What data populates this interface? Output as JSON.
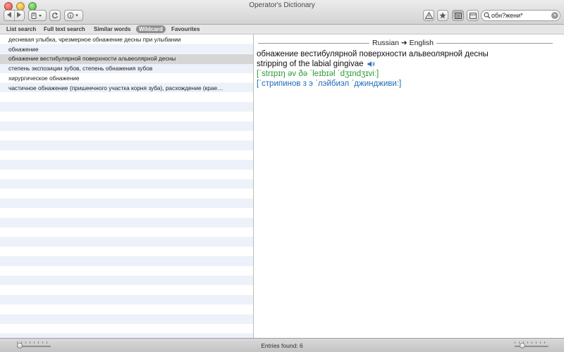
{
  "window": {
    "title": "Operator's Dictionary"
  },
  "toolbar": {
    "back_icon": "chevron-left-icon",
    "forward_icon": "chevron-right-icon",
    "bookmark_menu_icon": "bookmark-menu-icon",
    "refresh_icon": "refresh-icon",
    "info_menu_icon": "info-menu-icon",
    "warning_icon": "warning-triangle-icon",
    "favourite_icon": "star-icon",
    "list_view_icon": "list-view-icon",
    "panel_icon": "panel-icon"
  },
  "search": {
    "value": "обн?жени*",
    "placeholder": ""
  },
  "tabs": [
    {
      "label": "List search",
      "active": false
    },
    {
      "label": "Full text search",
      "active": false
    },
    {
      "label": "Similar words",
      "active": false
    },
    {
      "label": "Wildcard",
      "active": true
    },
    {
      "label": "Favourites",
      "active": false
    }
  ],
  "results": [
    {
      "text": "десневая улыбка, чрезмерное обнажение десны при улыбании",
      "selected": false
    },
    {
      "text": "обнажение",
      "selected": false
    },
    {
      "text": "обнажение вестибулярной поверхности альвеолярной десны",
      "selected": true
    },
    {
      "text": "степень экспозиции зубов, степень обнажения зубов",
      "selected": false
    },
    {
      "text": "хирургическое обнажение",
      "selected": false
    },
    {
      "text": "частичное обнажение (пришеечного участка корня зуба), расхождение (крае…",
      "selected": false
    }
  ],
  "entry": {
    "direction": "Russian ➜ English",
    "headword": "обнажение вестибулярной поверхности альвеолярной десны",
    "translation": "stripping of the labial gingivae",
    "ipa": "[ˈstrɪpɪŋ əv ðə ˈleɪbɪəl ˈdʒɪndʒɪviː]",
    "transliteration": "[ˈстрипинов з э ˈлэйбиэл ˈджиндживи:]"
  },
  "status": {
    "entries_found": "Entries found: 6"
  },
  "colors": {
    "ipa": "#2a9a3a",
    "transliteration": "#1f6bb5",
    "highlight_red": "#d0241c",
    "selection": "#d6d6d6",
    "active_tab": "#8f8f8f"
  }
}
